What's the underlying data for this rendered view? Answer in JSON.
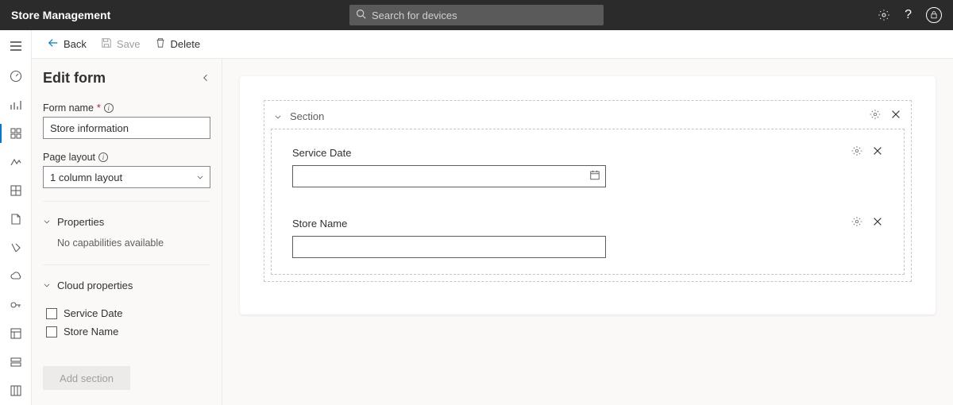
{
  "header": {
    "title": "Store Management",
    "search_placeholder": "Search for devices"
  },
  "toolbar": {
    "back": "Back",
    "save": "Save",
    "delete": "Delete"
  },
  "panel": {
    "title": "Edit form",
    "form_name_label": "Form name",
    "form_name_value": "Store information",
    "page_layout_label": "Page layout",
    "page_layout_value": "1 column layout",
    "properties_label": "Properties",
    "properties_empty": "No capabilities available",
    "cloud_properties_label": "Cloud properties",
    "cloud_items": [
      {
        "label": "Service Date"
      },
      {
        "label": "Store Name"
      }
    ],
    "add_section": "Add section"
  },
  "canvas": {
    "section_label": "Section",
    "fields": [
      {
        "label": "Service Date",
        "type": "date"
      },
      {
        "label": "Store Name",
        "type": "text"
      }
    ]
  }
}
